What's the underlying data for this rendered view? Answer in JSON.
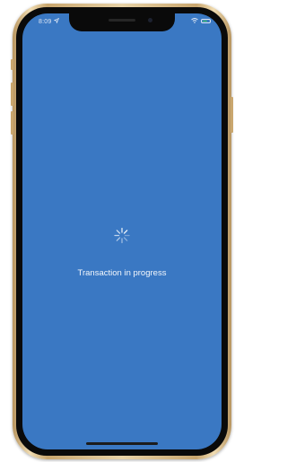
{
  "status_bar": {
    "time": "8:09",
    "location_icon": "location-arrow-icon",
    "wifi_icon": "wifi-icon",
    "battery_icon": "battery-icon",
    "battery_level": 0.7
  },
  "loading": {
    "spinner_icon": "spinner-icon",
    "message": "Transaction in progress"
  },
  "colors": {
    "screen_background": "#3a78c3",
    "text": "#f3f7fc",
    "battery_fill": "#4cd964",
    "frame_gold": "#e8d3a8"
  }
}
